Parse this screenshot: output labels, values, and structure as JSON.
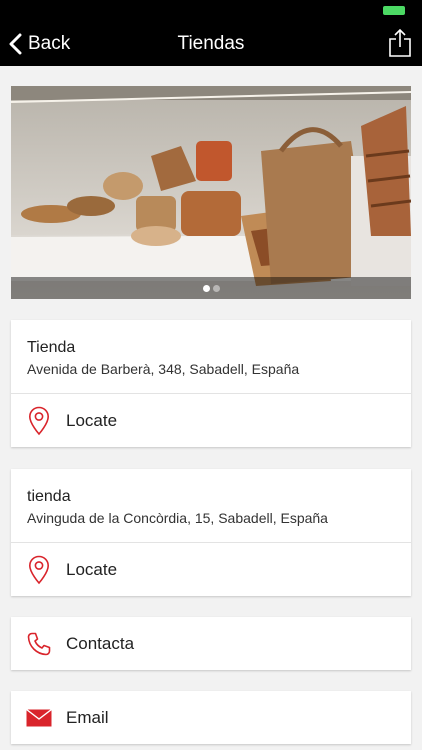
{
  "nav": {
    "back_label": "Back",
    "title": "Tiendas"
  },
  "gallery": {
    "image": "storefront-shoes-bags-photo",
    "page_count": 2,
    "current_page": 1
  },
  "stores": [
    {
      "name": "Tienda",
      "address": "Avenida de Barberà, 348, Sabadell, España",
      "locate_label": "Locate"
    },
    {
      "name": "tienda",
      "address": "Avinguda de la Concòrdia, 15, Sabadell, España",
      "locate_label": "Locate"
    }
  ],
  "contact": {
    "label": "Contacta",
    "icon": "phone-icon"
  },
  "email": {
    "label": "Email",
    "icon": "envelope-icon"
  },
  "colors": {
    "accent": "#d9242b",
    "bar": "#000000",
    "battery": "#4cd964"
  }
}
